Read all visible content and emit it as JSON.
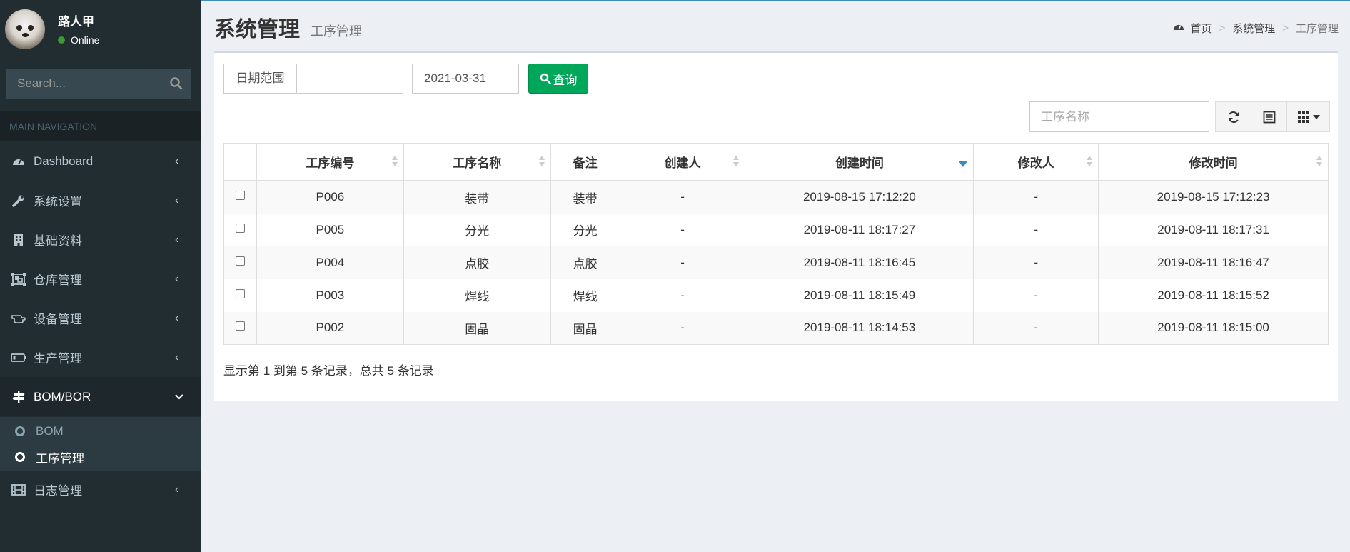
{
  "user": {
    "name": "路人甲",
    "status": "Online"
  },
  "sidebar": {
    "search_placeholder": "Search...",
    "header": "MAIN NAVIGATION",
    "items": [
      {
        "label": "Dashboard",
        "icon": "dashboard-icon"
      },
      {
        "label": "系统设置",
        "icon": "wrench-icon"
      },
      {
        "label": "基础资料",
        "icon": "building-icon"
      },
      {
        "label": "仓库管理",
        "icon": "object-group-icon"
      },
      {
        "label": "设备管理",
        "icon": "hand-icon"
      },
      {
        "label": "生产管理",
        "icon": "battery-icon"
      },
      {
        "label": "BOM/BOR",
        "icon": "signs-icon"
      },
      {
        "label": "日志管理",
        "icon": "film-icon"
      }
    ],
    "sub_items": [
      {
        "label": "BOM"
      },
      {
        "label": "工序管理"
      }
    ]
  },
  "header": {
    "title": "系统管理",
    "subtitle": "工序管理",
    "breadcrumb": [
      "首页",
      "系统管理",
      "工序管理"
    ]
  },
  "toolbar": {
    "range_label": "日期范围",
    "date_value": "2021-03-31",
    "query_label": "查询",
    "search_placeholder": "工序名称"
  },
  "table": {
    "columns": [
      "工序编号",
      "工序名称",
      "备注",
      "创建人",
      "创建时间",
      "修改人",
      "修改时间"
    ],
    "rows": [
      [
        "P006",
        "装带",
        "装带",
        "-",
        "2019-08-15 17:12:20",
        "-",
        "2019-08-15 17:12:23"
      ],
      [
        "P005",
        "分光",
        "分光",
        "-",
        "2019-08-11 18:17:27",
        "-",
        "2019-08-11 18:17:31"
      ],
      [
        "P004",
        "点胶",
        "点胶",
        "-",
        "2019-08-11 18:16:45",
        "-",
        "2019-08-11 18:16:47"
      ],
      [
        "P003",
        "焊线",
        "焊线",
        "-",
        "2019-08-11 18:15:49",
        "-",
        "2019-08-11 18:15:52"
      ],
      [
        "P002",
        "固晶",
        "固晶",
        "-",
        "2019-08-11 18:14:53",
        "-",
        "2019-08-11 18:15:00"
      ]
    ]
  },
  "pagination": {
    "info": "显示第 1 到第 5 条记录，总共 5 条记录"
  },
  "colors": {
    "sidebar_bg": "#222d32",
    "accent": "#3c8dbc",
    "success": "#00a65a"
  }
}
